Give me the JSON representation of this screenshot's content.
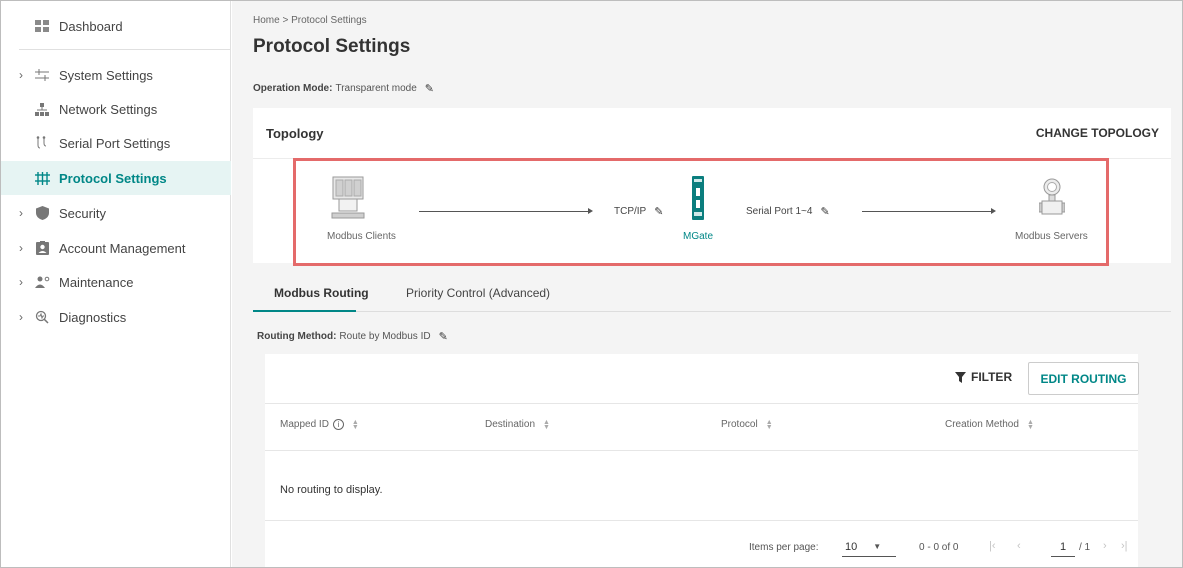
{
  "sidebar": {
    "items": [
      {
        "label": "Dashboard",
        "icon": "dashboard-icon",
        "expandable": false
      },
      {
        "label": "System Settings",
        "icon": "sliders-icon",
        "expandable": true
      },
      {
        "label": "Network Settings",
        "icon": "network-icon",
        "expandable": false
      },
      {
        "label": "Serial Port Settings",
        "icon": "serial-port-icon",
        "expandable": false
      },
      {
        "label": "Protocol Settings",
        "icon": "protocol-icon",
        "expandable": false,
        "active": true
      },
      {
        "label": "Security",
        "icon": "shield-icon",
        "expandable": true
      },
      {
        "label": "Account Management",
        "icon": "account-icon",
        "expandable": true
      },
      {
        "label": "Maintenance",
        "icon": "maintenance-icon",
        "expandable": true
      },
      {
        "label": "Diagnostics",
        "icon": "diagnostics-icon",
        "expandable": true
      }
    ]
  },
  "breadcrumb": "Home > Protocol Settings",
  "page_title": "Protocol Settings",
  "operation_mode": {
    "label": "Operation Mode:",
    "value": "Transparent mode"
  },
  "topology": {
    "title": "Topology",
    "change_button": "CHANGE TOPOLOGY",
    "left_node": "Modbus Clients",
    "left_connection": "TCP/IP",
    "center_node": "MGate",
    "right_connection": "Serial Port 1~4",
    "right_node": "Modbus Servers"
  },
  "tabs": [
    {
      "label": "Modbus Routing",
      "active": true
    },
    {
      "label": "Priority Control (Advanced)",
      "active": false
    }
  ],
  "routing_method": {
    "label": "Routing Method:",
    "value": "Route by Modbus ID"
  },
  "routing_table": {
    "filter_label": "FILTER",
    "edit_button": "EDIT ROUTING",
    "columns": [
      "Mapped ID",
      "Destination",
      "Protocol",
      "Creation Method"
    ],
    "empty_message": "No routing to display."
  },
  "pagination": {
    "items_per_page_label": "Items per page:",
    "items_per_page": "10",
    "range": "0 - 0 of 0",
    "current_page": "1",
    "total_pages": "/ 1"
  },
  "colors": {
    "accent": "#008787",
    "highlight": "#e46a6a"
  }
}
